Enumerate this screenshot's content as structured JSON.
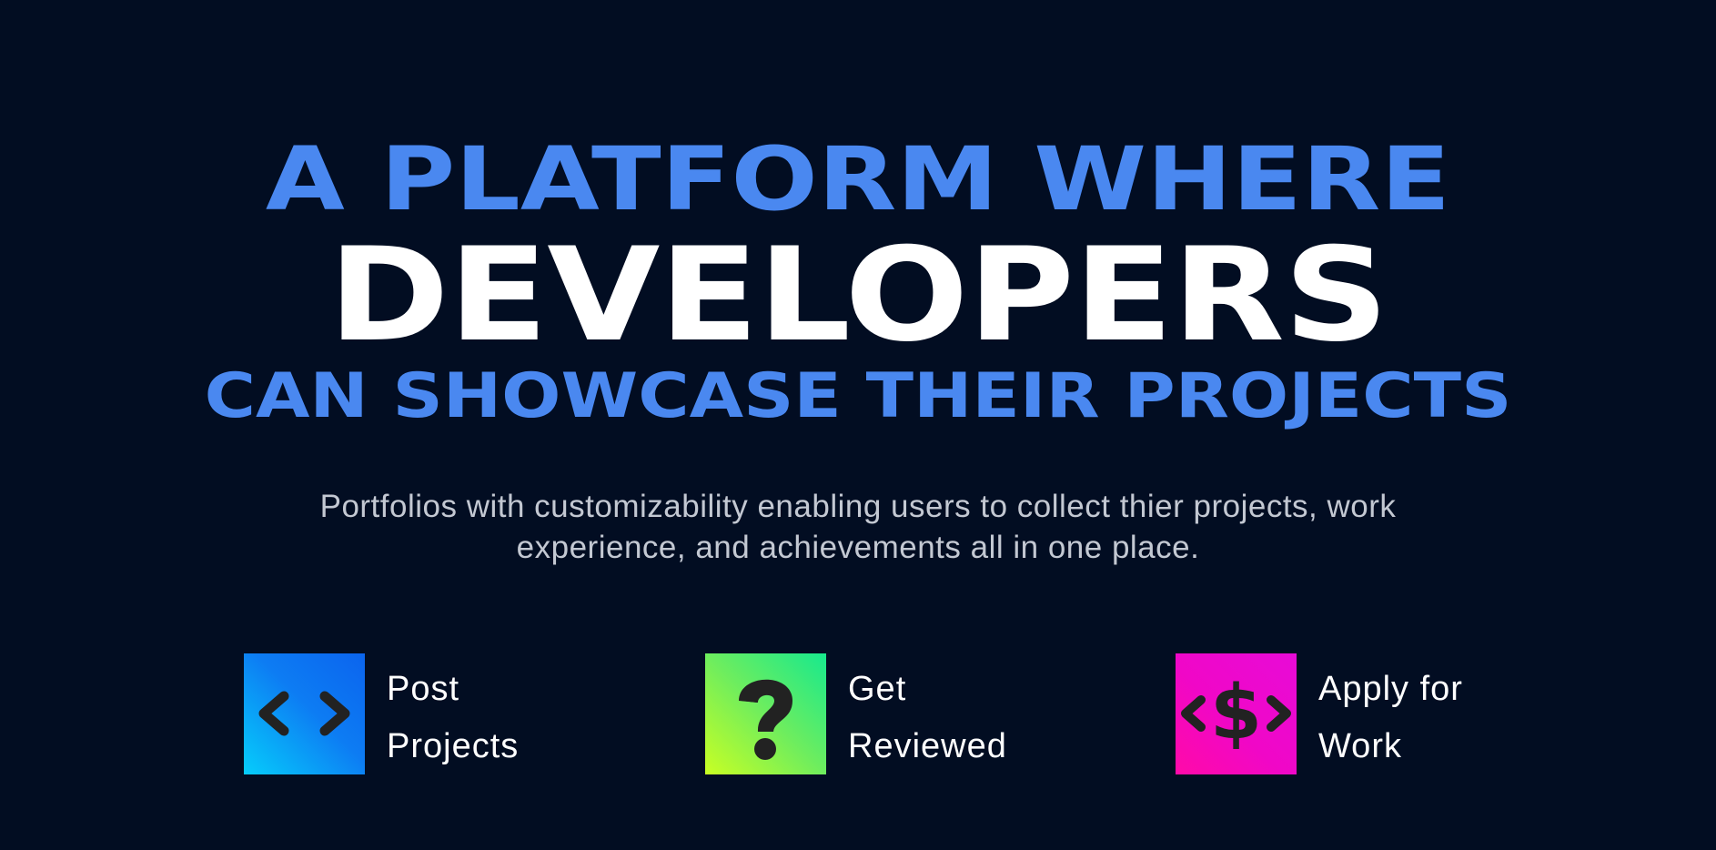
{
  "hero": {
    "line1": "A PLATFORM WHERE",
    "line2": "DEVELOPERS",
    "line3": "CAN SHOWCASE THEIR PROJECTS"
  },
  "subtitle": {
    "line1": "Portfolios with customizability enabling users to collect thier projects, work",
    "line2": "experience, and achievements all in one place."
  },
  "features": [
    {
      "icon": "code-icon",
      "line1": "Post",
      "line2": "Projects"
    },
    {
      "icon": "question-mark-icon",
      "line1": "Get",
      "line2": "Reviewed"
    },
    {
      "icon": "dollar-code-icon",
      "line1": "Apply for",
      "line2": "Work"
    }
  ],
  "colors": {
    "background": "#020d22",
    "accent": "#4a88f0",
    "subtitle": "#c3c8d2",
    "icon_glyph": "#222222"
  }
}
